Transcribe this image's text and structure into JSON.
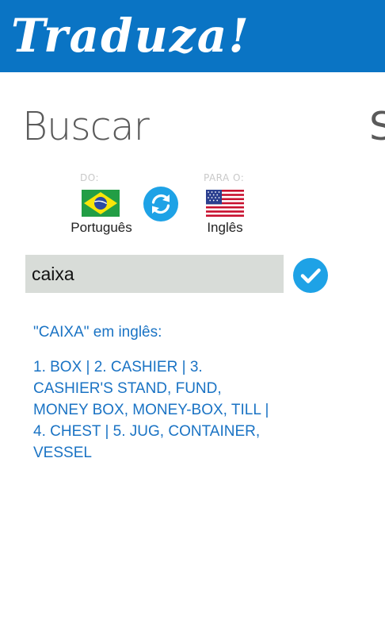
{
  "header": {
    "logo_text": "Traduza!"
  },
  "page": {
    "title": "Buscar",
    "next_title": "S"
  },
  "source_lang": {
    "caption": "DO:",
    "name": "Português",
    "flag_icon": "brazil-flag-icon"
  },
  "target_lang": {
    "caption": "PARA O:",
    "name": "Inglês",
    "flag_icon": "usa-flag-icon"
  },
  "swap_icon": "refresh-swap-icon",
  "search": {
    "value": "caixa",
    "confirm_icon": "checkmark-icon"
  },
  "result": {
    "heading": "\"CAIXA\" em inglês:",
    "body": "1. BOX | 2. CASHIER | 3. CASHIER'S STAND, FUND, MONEY BOX, MONEY-BOX, TILL | 4. CHEST | 5. JUG, CONTAINER, VESSEL"
  },
  "colors": {
    "header_bg": "#0a74c4",
    "accent": "#1ea2e6",
    "result_text": "#1a73c4",
    "input_bg": "#d8dcd8"
  }
}
